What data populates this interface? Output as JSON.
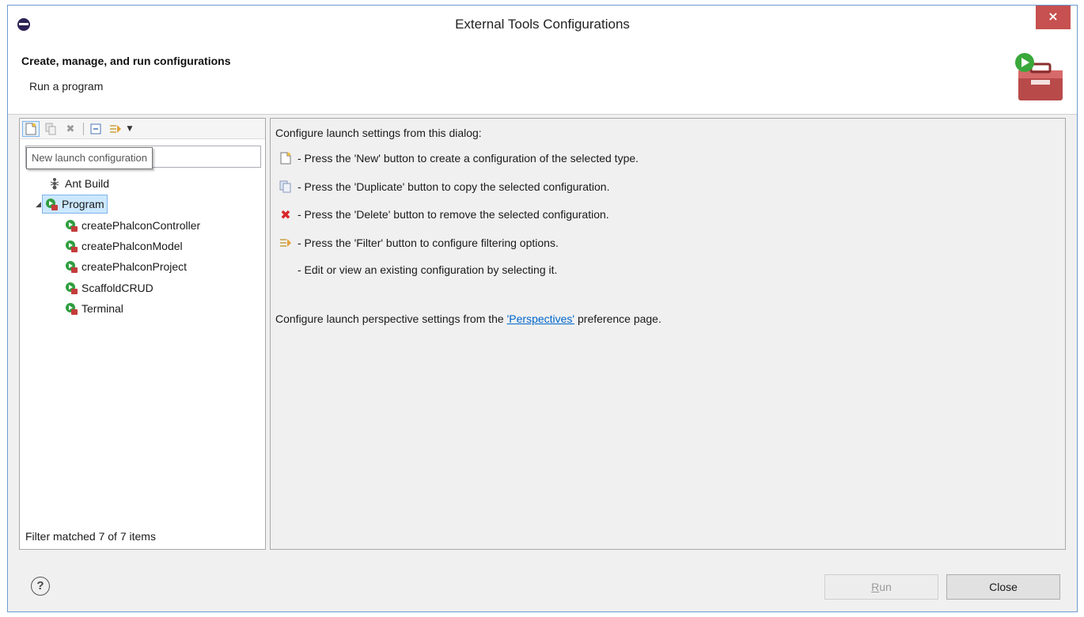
{
  "window": {
    "title": "External Tools Configurations",
    "close_symbol": "×"
  },
  "header": {
    "title": "Create, manage, and run configurations",
    "subtitle": "Run a program",
    "icon": "toolbox-run-icon"
  },
  "left_toolbar": {
    "items": [
      "new-config-icon",
      "duplicate-icon",
      "delete-icon",
      "collapse-all-icon",
      "filter-icon",
      "dropdown-icon"
    ]
  },
  "filter": {
    "value": "",
    "tooltip": "New launch configuration"
  },
  "tree": {
    "items": [
      {
        "label": "Ant Build",
        "icon": "ant-icon",
        "level": 0
      },
      {
        "label": "Program",
        "icon": "program-icon",
        "level": 0,
        "selected": true,
        "expanded": true
      },
      {
        "label": "createPhalconController",
        "icon": "program-icon",
        "level": 1
      },
      {
        "label": "createPhalconModel",
        "icon": "program-icon",
        "level": 1
      },
      {
        "label": "createPhalconProject",
        "icon": "program-icon",
        "level": 1
      },
      {
        "label": "ScaffoldCRUD",
        "icon": "program-icon",
        "level": 1
      },
      {
        "label": "Terminal",
        "icon": "program-icon",
        "level": 1
      }
    ],
    "status": "Filter matched 7 of 7 items"
  },
  "info": {
    "intro": "Configure launch settings from this dialog:",
    "lines": [
      {
        "icon": "new-config-icon",
        "text": "- Press the 'New' button to create a configuration of the selected type."
      },
      {
        "icon": "duplicate-icon",
        "text": "- Press the 'Duplicate' button to copy the selected configuration."
      },
      {
        "icon": "delete-icon",
        "text": "- Press the 'Delete' button to remove the selected configuration."
      },
      {
        "icon": "filter-icon",
        "text": "- Press the 'Filter' button to configure filtering options."
      },
      {
        "icon": "",
        "text": "- Edit or view an existing configuration by selecting it."
      }
    ],
    "perspectives_prefix": "Configure launch perspective settings from the ",
    "perspectives_link": "'Perspectives'",
    "perspectives_suffix": " preference page."
  },
  "buttons": {
    "help": "?",
    "run_mnemonic": "R",
    "run_rest": "un",
    "close": "Close"
  },
  "colors": {
    "accent": "#0066cc",
    "selection": "#cce8ff",
    "close_bg": "#c75050",
    "delete_red": "#d9262b",
    "program_green": "#2e9e3e"
  }
}
